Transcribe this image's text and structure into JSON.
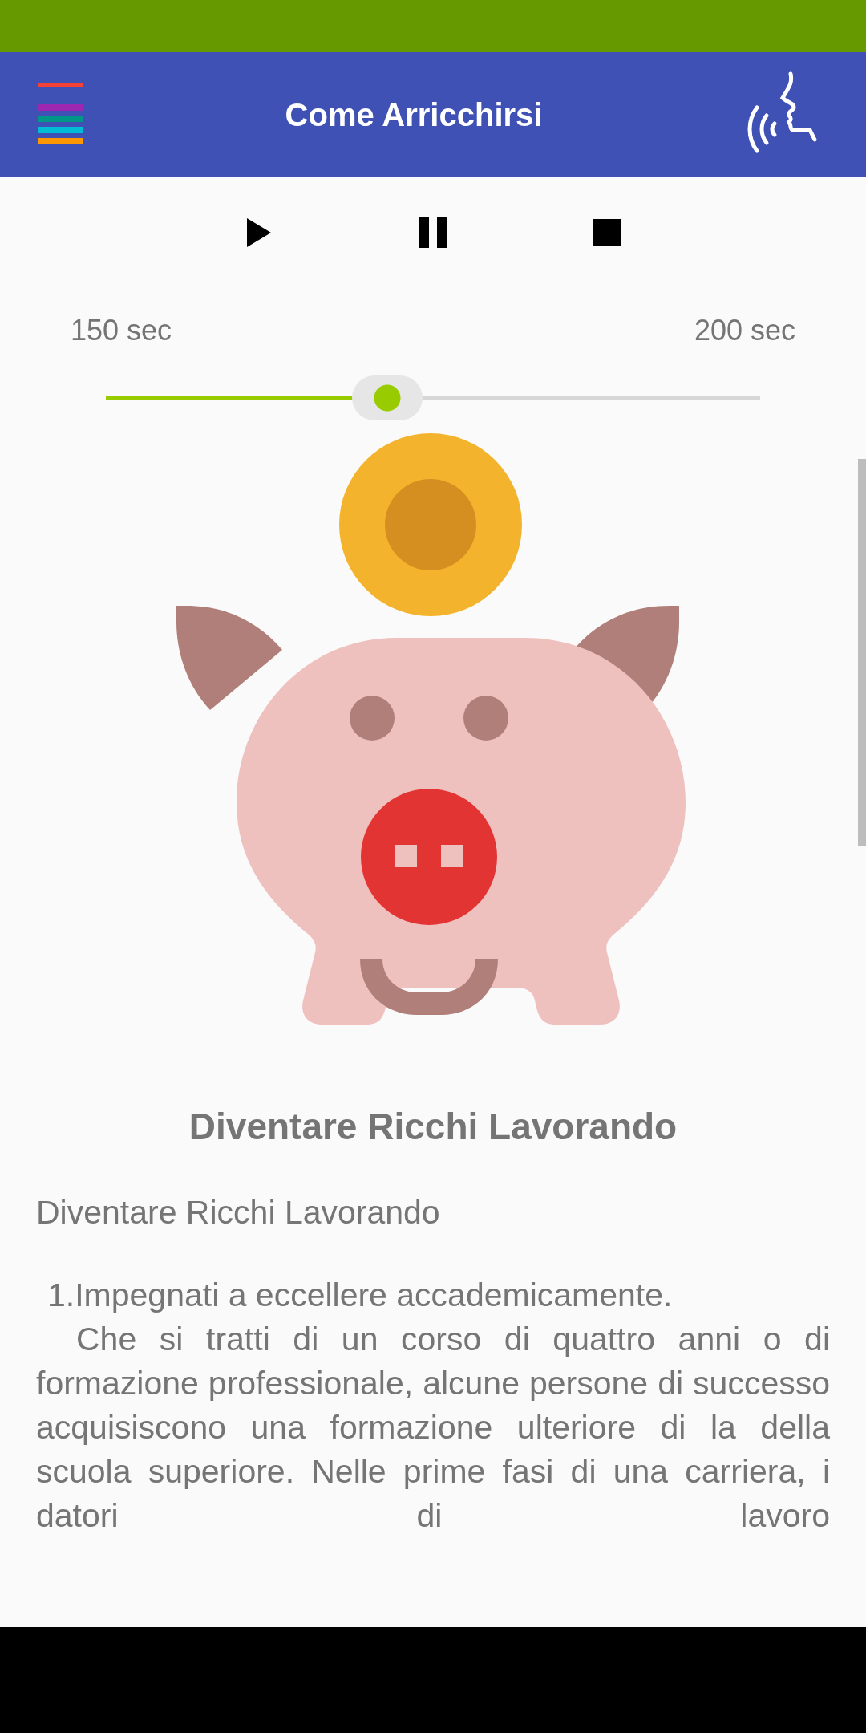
{
  "app_bar": {
    "title": "Come Arricchirsi"
  },
  "player": {
    "buttons": [
      {
        "kind": "play"
      },
      {
        "kind": "pause"
      },
      {
        "kind": "stop"
      }
    ],
    "start_label": "150 sec",
    "end_label": "200 sec",
    "slider": {
      "level": 0.43
    }
  },
  "article": {
    "heading": "Diventare Ricchi Lavorando",
    "intro": "Diventare Ricchi Lavorando",
    "point": "1.Impegnati a eccellere accademicamente.",
    "paragraph": "Che si tratti di un corso di quattro anni o di formazione professionale, alcune persone di successo acquisiscono una formazione ulteriore di la della scuola superiore. Nelle prime fasi di una carriera, i datori di lavoro"
  }
}
